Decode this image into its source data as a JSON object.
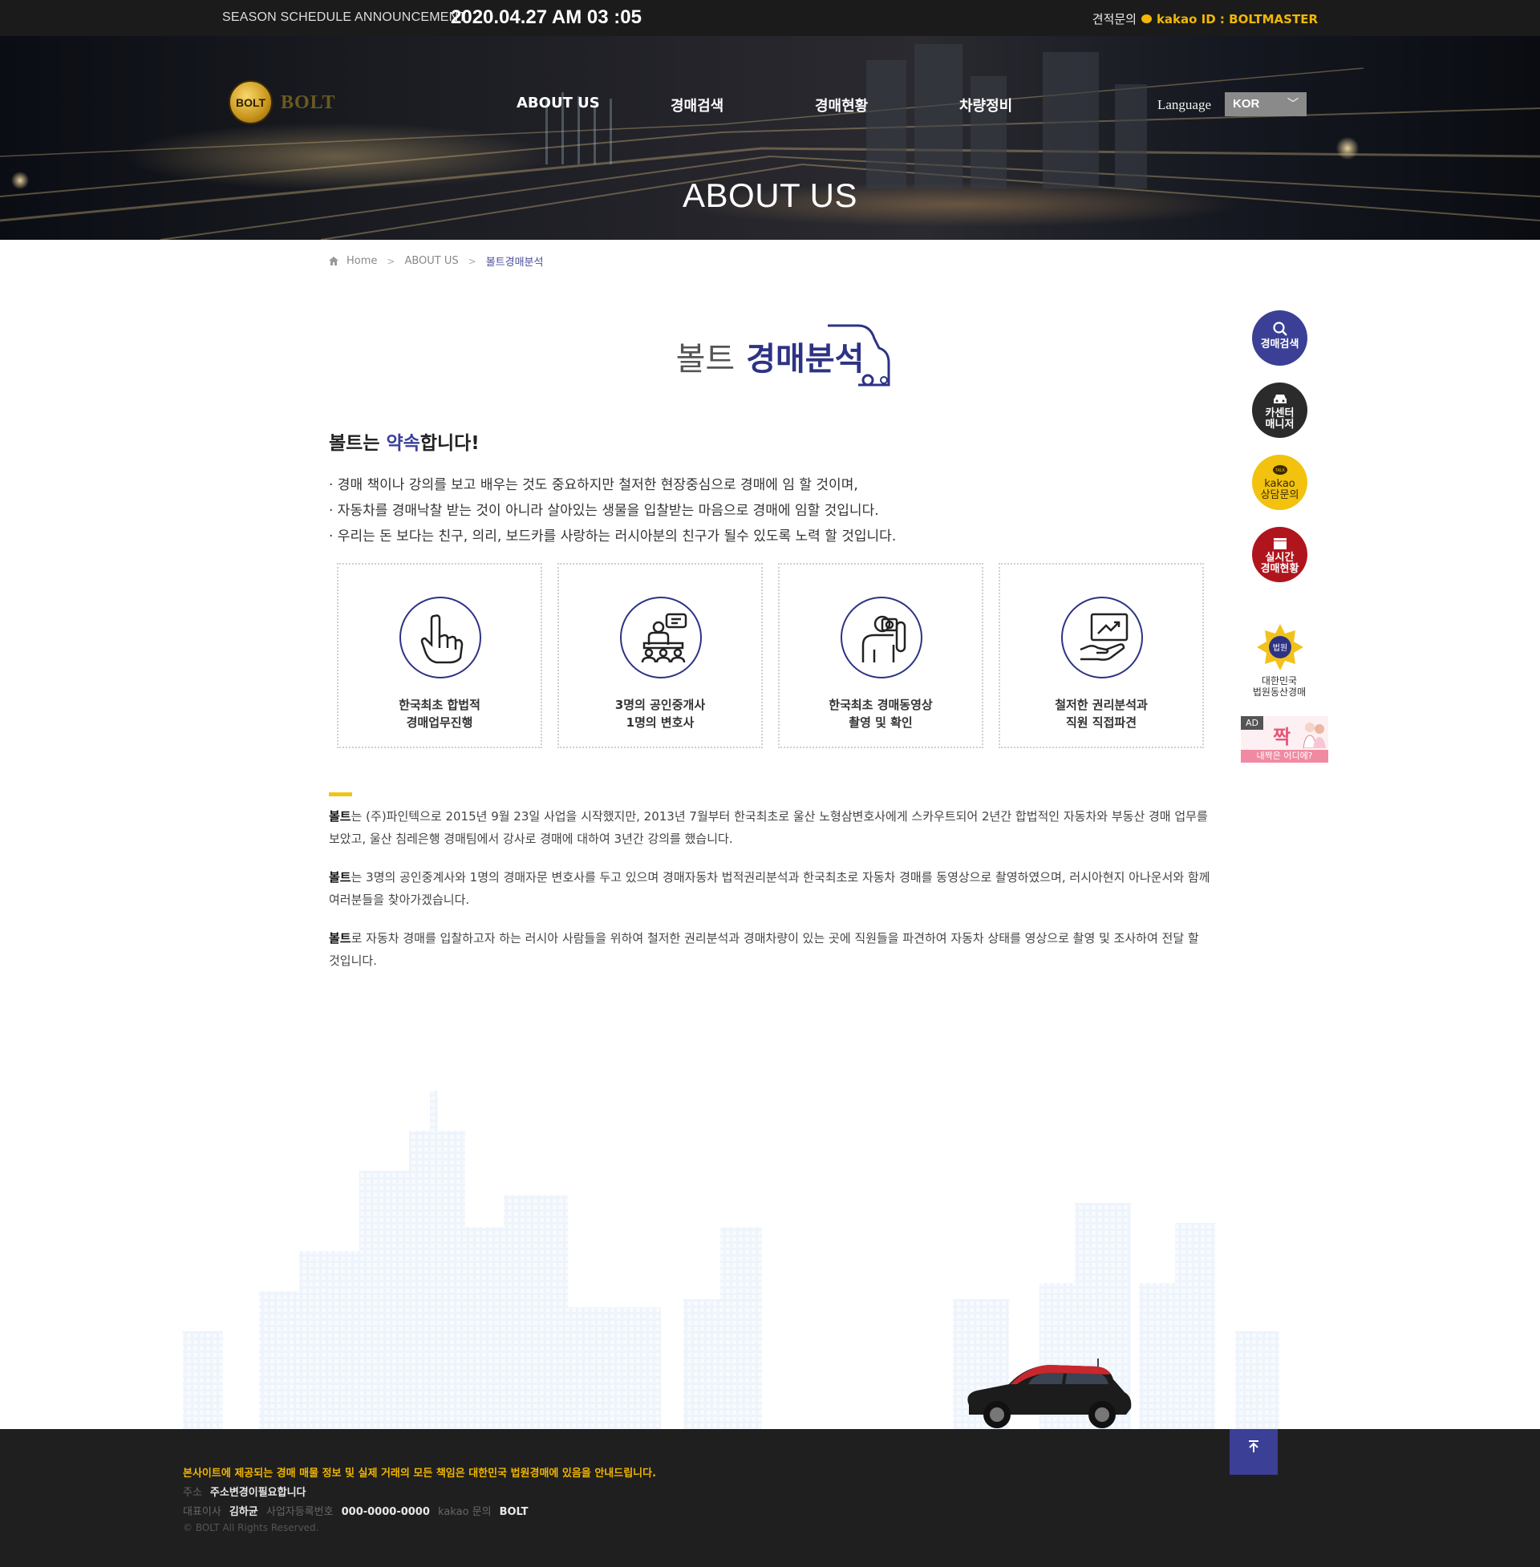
{
  "topbar": {
    "announcement": "SEASON SCHEDULE ANNOUNCEMENT",
    "datetime": "2020.04.27 AM 03 :05",
    "inquiry_label": "견적문의",
    "kakao_id": "kakao ID : BOLTMASTER"
  },
  "header": {
    "logo_badge": "BOLT",
    "logo_text": "BOLT",
    "nav": [
      "ABOUT US",
      "경매검색",
      "경매현황",
      "차량정비"
    ],
    "language_label": "Language",
    "language_value": "KOR"
  },
  "hero": {
    "title": "ABOUT US"
  },
  "breadcrumb": {
    "home": "Home",
    "parent": "ABOUT US",
    "current": "볼트경매분석"
  },
  "section": {
    "title_light": "볼트",
    "title_bold": "경매분석",
    "promise_prefix": "볼트는 ",
    "promise_highlight": "약속",
    "promise_suffix": "합니다!",
    "bullets": [
      "· 경매 책이나 강의를 보고 배우는 것도 중요하지만 철저한 현장중심으로 경매에 임 할 것이며,",
      "· 자동차를 경매낙찰 받는 것이 아니라 살아있는 생물을 입찰받는 마음으로 경매에 임할 것입니다.",
      "· 우리는 돈 보다는 친구, 의리, 보드카를 사랑하는 러시아분의 친구가 될수 있도록 노력 할 것입니다."
    ]
  },
  "features": [
    {
      "icon": "pointing-hand-icon",
      "line1": "한국최초 합법적",
      "line2": "경매업무진행"
    },
    {
      "icon": "presenter-group-icon",
      "line1": "3명의 공인중개사",
      "line2": "1명의 변호사"
    },
    {
      "icon": "camera-operator-icon",
      "line1": "한국최초 경매동영상",
      "line2": "촬영 및 확인"
    },
    {
      "icon": "chart-hand-icon",
      "line1": "철저한 권리분석과",
      "line2": "직원 직접파견"
    }
  ],
  "paragraphs": [
    {
      "brand": "볼트",
      "text": "는 (주)파인텍으로 2015년 9월 23일 사업을 시작했지만, 2013년 7월부터 한국최초로 울산 노형삼변호사에게 스카우트되어 2년간 합법적인 자동차와 부동산 경매 업무를 보았고, 울산 침레은행 경매팀에서 강사로 경매에 대하여 3년간 강의를 했습니다."
    },
    {
      "brand": "볼트",
      "text": "는 3명의 공인중계사와 1명의 경매자문 변호사를 두고 있으며 경매자동차 법적권리분석과 한국최초로 자동차 경매를 동영상으로 촬영하였으며, 러시아현지 아나운서와 함께 여러분들을 찾아가겠습니다."
    },
    {
      "brand": "볼트",
      "text": "로 자동차 경매를 입찰하고자 하는 러시아 사람들을 위하여 철저한 권리분석과 경매차량이 있는 곳에 직원들을 파견하여 자동차 상태를 영상으로 촬영 및 조사하여 전달 할 것입니다."
    }
  ],
  "quick_menu": [
    {
      "line1": "경매검색",
      "line2": "",
      "color": "#3b3f95"
    },
    {
      "line1": "카센터",
      "line2": "매니저",
      "color": "#2b2b2b"
    },
    {
      "line1": "kakao",
      "line2": "상담문의",
      "color": "#f2c20f"
    },
    {
      "line1": "실시간",
      "line2": "경매현황",
      "color": "#b0151e"
    }
  ],
  "court": {
    "line1": "대한민국",
    "line2": "법원동산경매"
  },
  "ad": {
    "tag": "AD",
    "main": "짝",
    "sub": "내짝은 어디에?"
  },
  "footer": {
    "notice": "본사이트에 제공되는 경매 매물 정보 및 실제 거래의 모든 책임은 대한민국 법원경매에 있음을 안내드립니다.",
    "address_label": "주소",
    "address_value": "주소변경이필요합니다",
    "ceo_label": "대표이사",
    "ceo_value": "김하균",
    "bizno_label": "사업자등록번호",
    "bizno_value": "000-0000-0000",
    "kakao_label": "kakao 문의",
    "kakao_value": "BOLT",
    "copyright": "© BOLT All Rights Reserved."
  },
  "colors": {
    "brand_navy": "#2d3384",
    "accent_yellow": "#f0c419",
    "topbar_bg": "#1b1b1b",
    "footer_bg": "#1f1f1f"
  }
}
